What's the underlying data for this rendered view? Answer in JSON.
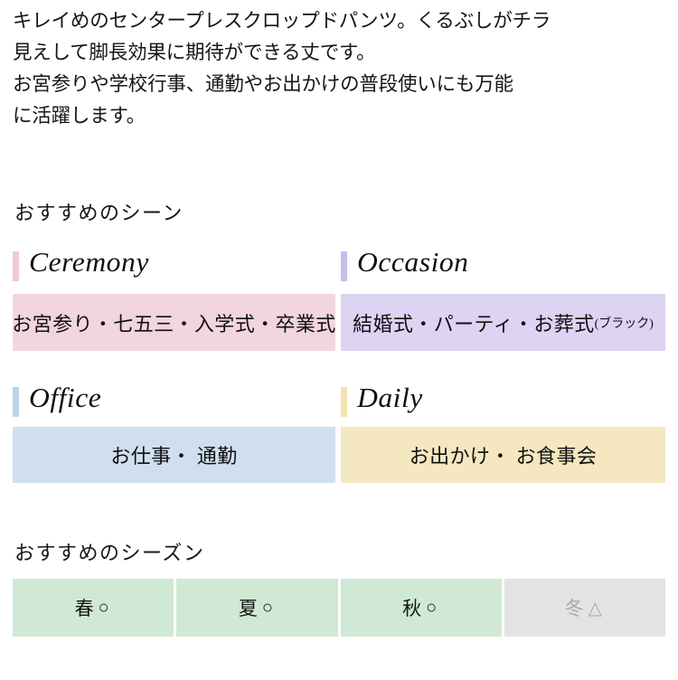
{
  "intro": {
    "line1": "キレイめのセンタープレスクロップドパンツ。くるぶしがチラ",
    "line2": "見えして脚長効果に期待ができる丈です。",
    "line3": "お宮参りや学校行事、通勤やお出かけの普段使いにも万能",
    "line4": "に活躍します。"
  },
  "scene": {
    "title": "おすすめのシーン",
    "items": [
      {
        "script_label": "Ceremony",
        "accent_color": "#f3c9d6",
        "box_color": "#f2d5de",
        "text": "お宮参り・七五三・入学式・卒業式",
        "sub": ""
      },
      {
        "script_label": "Occasion",
        "accent_color": "#c9bbe8",
        "box_color": "#ddd3f2",
        "text": "結婚式・パーティ・お葬式",
        "sub": "(ブラック)"
      },
      {
        "script_label": "Office",
        "accent_color": "#bcd4ec",
        "box_color": "#cfdff0",
        "text": "お仕事・ 通勤",
        "sub": ""
      },
      {
        "script_label": "Daily",
        "accent_color": "#f5e3ae",
        "box_color": "#f5e7bf",
        "text": "お出かけ・ お食事会",
        "sub": ""
      }
    ]
  },
  "season": {
    "title": "おすすめのシーズン",
    "cells": [
      {
        "name": "春",
        "mark": "○",
        "available": true,
        "color": "#cfe9d4"
      },
      {
        "name": "夏",
        "mark": "○",
        "available": true,
        "color": "#cfe9d4"
      },
      {
        "name": "秋",
        "mark": "○",
        "available": true,
        "color": "#cfe9d4"
      },
      {
        "name": "冬",
        "mark": "△",
        "available": false,
        "color": "#e3e3e3"
      }
    ]
  }
}
